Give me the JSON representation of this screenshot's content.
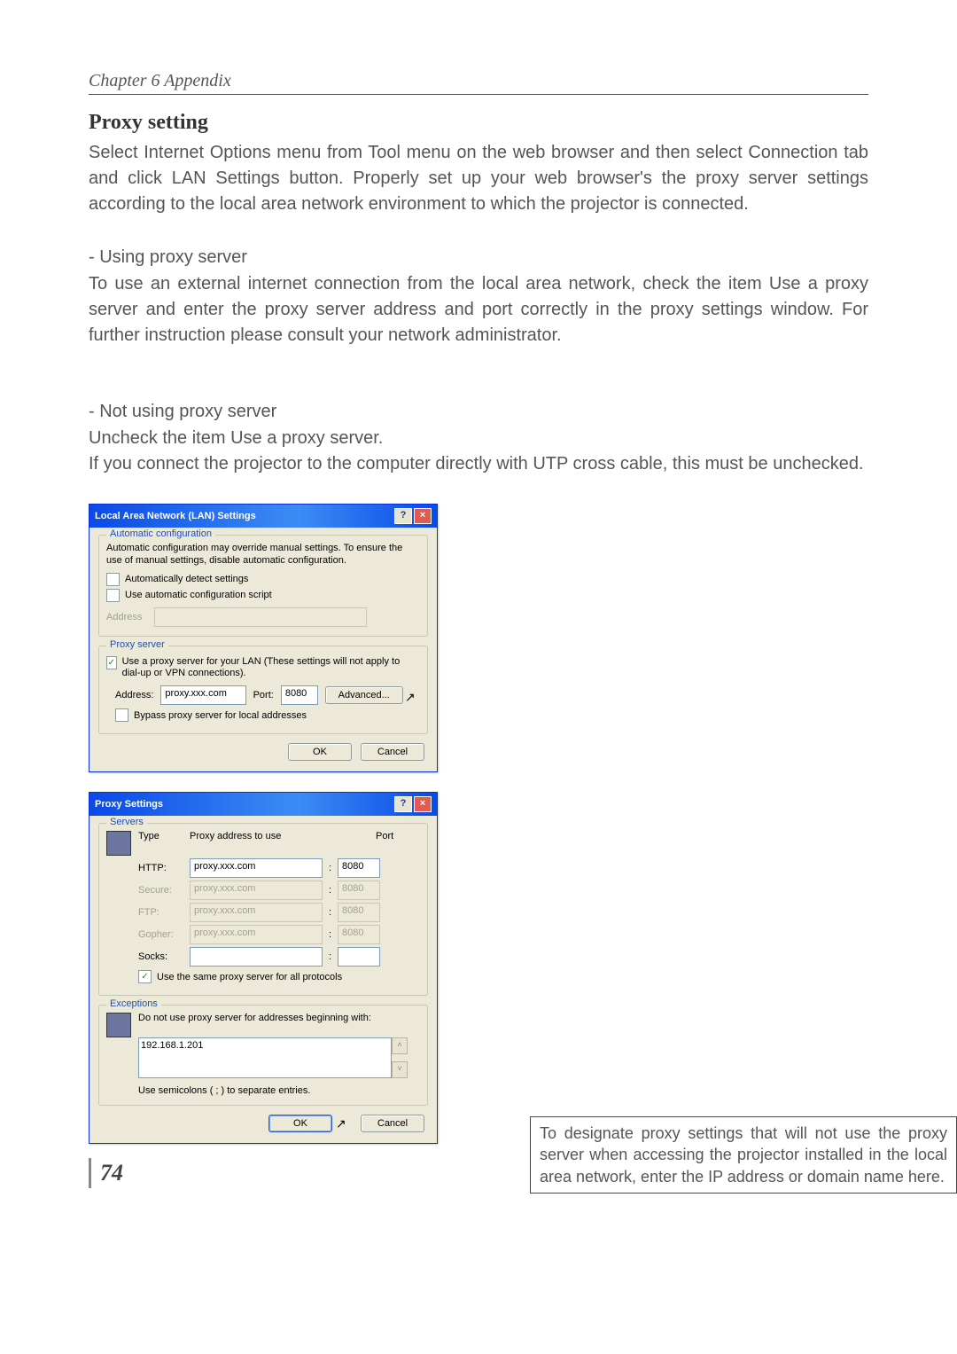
{
  "header": "Chapter 6 Appendix",
  "section_title": "Proxy setting",
  "intro": "Select Internet Options menu from Tool menu on the web browser and then select Connection tab and click LAN Settings button. Properly set up your web browser's the proxy server settings according to the local area network environment to which the projector is connected.",
  "sub1_title": "- Using proxy server",
  "sub1_body": "To use an external internet connection from the local area network, check the item Use a proxy server and enter the proxy server address and port correctly in the proxy settings window. For further instruction please consult your network administrator.",
  "sub2_title": "- Not using proxy server",
  "sub2_line1": "Uncheck the item Use a proxy server.",
  "sub2_line2": "If you connect the projector to the computer directly with UTP cross cable, this must be unchecked.",
  "dlg1": {
    "title": "Local Area Network (LAN) Settings",
    "group1_title": "Automatic configuration",
    "group1_desc": "Automatic configuration may override manual settings.  To ensure the use of manual settings, disable automatic configuration.",
    "chk1": "Automatically detect settings",
    "chk2": "Use automatic configuration script",
    "addr_label": "Address",
    "group2_title": "Proxy server",
    "chk3": "Use a proxy server for your LAN (These settings will not apply to dial-up or VPN connections).",
    "addr2_label": "Address:",
    "addr2_val": "proxy.xxx.com",
    "port_label": "Port:",
    "port_val": "8080",
    "adv_btn": "Advanced...",
    "chk4": "Bypass proxy server for local addresses",
    "ok": "OK",
    "cancel": "Cancel"
  },
  "dlg2": {
    "title": "Proxy Settings",
    "group1_title": "Servers",
    "h_type": "Type",
    "h_addr": "Proxy address to use",
    "h_port": "Port",
    "rows": [
      {
        "label": "HTTP:",
        "addr": "proxy.xxx.com",
        "port": "8080",
        "enabled": true
      },
      {
        "label": "Secure:",
        "addr": "proxy.xxx.com",
        "port": "8080",
        "enabled": false
      },
      {
        "label": "FTP:",
        "addr": "proxy.xxx.com",
        "port": "8080",
        "enabled": false
      },
      {
        "label": "Gopher:",
        "addr": "proxy.xxx.com",
        "port": "8080",
        "enabled": false
      },
      {
        "label": "Socks:",
        "addr": "",
        "port": "",
        "enabled": true
      }
    ],
    "same_chk": "Use the same proxy server for all protocols",
    "group2_title": "Exceptions",
    "excep_label": "Do not use proxy server for addresses beginning with:",
    "excep_val": "192.168.1.201",
    "hint": "Use semicolons ( ; ) to separate entries.",
    "ok": "OK",
    "cancel": "Cancel"
  },
  "callout": "To designate proxy settings that will not use the proxy server when accessing the projector installed in the local area network, enter the IP address or domain name here.",
  "page_number": "74"
}
